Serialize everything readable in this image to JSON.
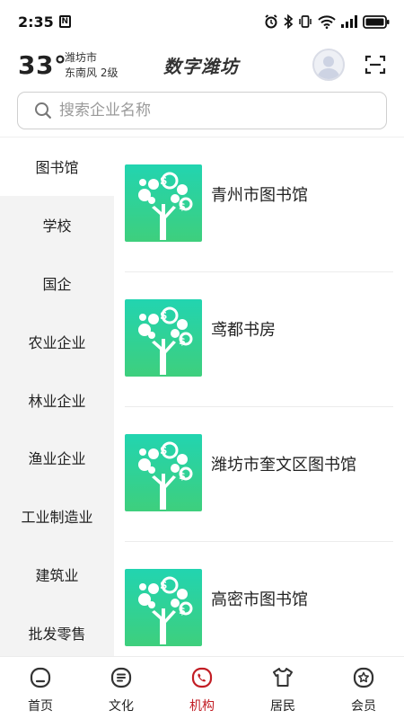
{
  "status_bar": {
    "time": "2:35"
  },
  "header": {
    "temperature": "33°",
    "city": "潍坊市",
    "wind": "东南风  2级",
    "brand_title": "数字潍坊"
  },
  "search": {
    "placeholder": "搜索企业名称"
  },
  "sidebar": {
    "items": [
      {
        "label": "图书馆",
        "active": true
      },
      {
        "label": "学校"
      },
      {
        "label": "国企"
      },
      {
        "label": "农业企业"
      },
      {
        "label": "林业企业"
      },
      {
        "label": "渔业企业"
      },
      {
        "label": "工业制造业"
      },
      {
        "label": "建筑业"
      },
      {
        "label": "批发零售"
      }
    ]
  },
  "list": {
    "items": [
      {
        "name": "青州市图书馆",
        "icon": "money-tree-icon"
      },
      {
        "name": "鸢都书房",
        "icon": "money-tree-icon"
      },
      {
        "name": "潍坊市奎文区图书馆",
        "icon": "money-tree-icon"
      },
      {
        "name": "高密市图书馆",
        "icon": "money-tree-icon"
      }
    ]
  },
  "bottom_nav": {
    "active_color": "#c21d24",
    "items": [
      {
        "label": "首页",
        "icon": "home-icon"
      },
      {
        "label": "文化",
        "icon": "culture-icon"
      },
      {
        "label": "机构",
        "icon": "institution-icon",
        "active": true
      },
      {
        "label": "居民",
        "icon": "resident-icon"
      },
      {
        "label": "会员",
        "icon": "member-icon"
      }
    ]
  },
  "colors": {
    "accent": "#c21d24",
    "thumb_top": "#22d4b0",
    "thumb_bottom": "#3ecf7d",
    "sidebar_bg": "#f3f3f3"
  }
}
